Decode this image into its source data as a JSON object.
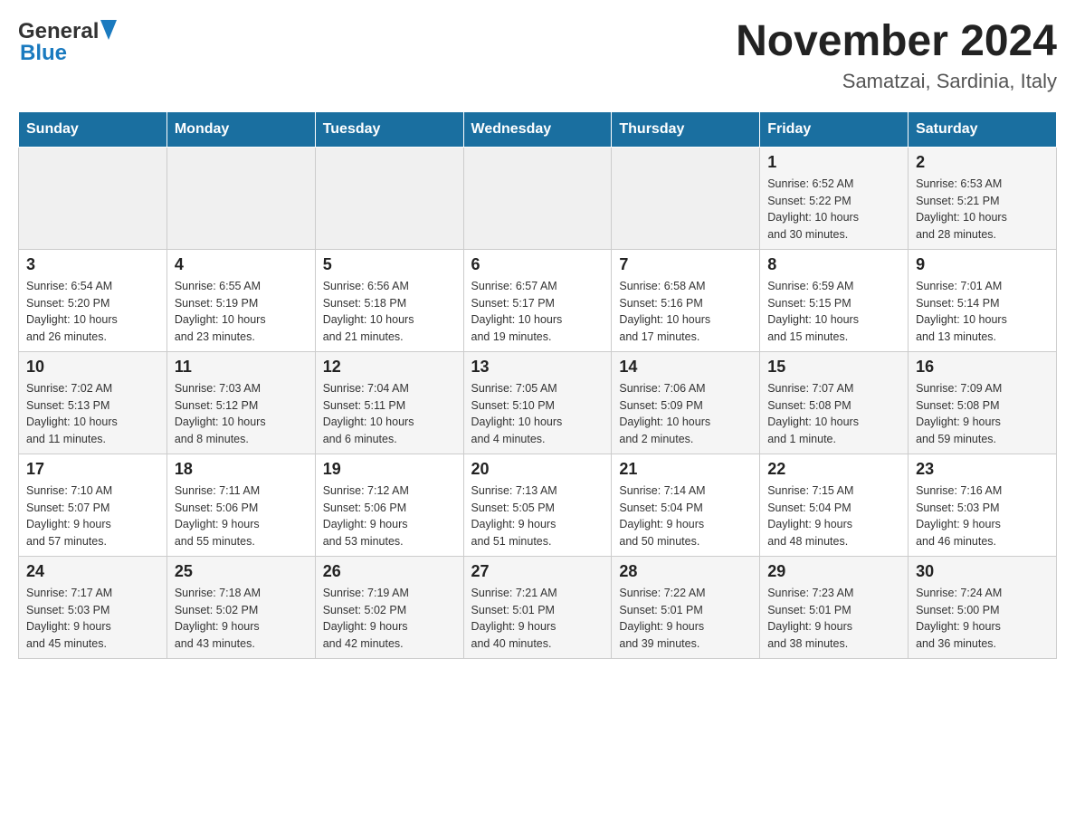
{
  "header": {
    "logo_general": "General",
    "logo_blue": "Blue",
    "title": "November 2024",
    "subtitle": "Samatzai, Sardinia, Italy"
  },
  "weekdays": [
    "Sunday",
    "Monday",
    "Tuesday",
    "Wednesday",
    "Thursday",
    "Friday",
    "Saturday"
  ],
  "weeks": [
    [
      {
        "day": "",
        "info": ""
      },
      {
        "day": "",
        "info": ""
      },
      {
        "day": "",
        "info": ""
      },
      {
        "day": "",
        "info": ""
      },
      {
        "day": "",
        "info": ""
      },
      {
        "day": "1",
        "info": "Sunrise: 6:52 AM\nSunset: 5:22 PM\nDaylight: 10 hours\nand 30 minutes."
      },
      {
        "day": "2",
        "info": "Sunrise: 6:53 AM\nSunset: 5:21 PM\nDaylight: 10 hours\nand 28 minutes."
      }
    ],
    [
      {
        "day": "3",
        "info": "Sunrise: 6:54 AM\nSunset: 5:20 PM\nDaylight: 10 hours\nand 26 minutes."
      },
      {
        "day": "4",
        "info": "Sunrise: 6:55 AM\nSunset: 5:19 PM\nDaylight: 10 hours\nand 23 minutes."
      },
      {
        "day": "5",
        "info": "Sunrise: 6:56 AM\nSunset: 5:18 PM\nDaylight: 10 hours\nand 21 minutes."
      },
      {
        "day": "6",
        "info": "Sunrise: 6:57 AM\nSunset: 5:17 PM\nDaylight: 10 hours\nand 19 minutes."
      },
      {
        "day": "7",
        "info": "Sunrise: 6:58 AM\nSunset: 5:16 PM\nDaylight: 10 hours\nand 17 minutes."
      },
      {
        "day": "8",
        "info": "Sunrise: 6:59 AM\nSunset: 5:15 PM\nDaylight: 10 hours\nand 15 minutes."
      },
      {
        "day": "9",
        "info": "Sunrise: 7:01 AM\nSunset: 5:14 PM\nDaylight: 10 hours\nand 13 minutes."
      }
    ],
    [
      {
        "day": "10",
        "info": "Sunrise: 7:02 AM\nSunset: 5:13 PM\nDaylight: 10 hours\nand 11 minutes."
      },
      {
        "day": "11",
        "info": "Sunrise: 7:03 AM\nSunset: 5:12 PM\nDaylight: 10 hours\nand 8 minutes."
      },
      {
        "day": "12",
        "info": "Sunrise: 7:04 AM\nSunset: 5:11 PM\nDaylight: 10 hours\nand 6 minutes."
      },
      {
        "day": "13",
        "info": "Sunrise: 7:05 AM\nSunset: 5:10 PM\nDaylight: 10 hours\nand 4 minutes."
      },
      {
        "day": "14",
        "info": "Sunrise: 7:06 AM\nSunset: 5:09 PM\nDaylight: 10 hours\nand 2 minutes."
      },
      {
        "day": "15",
        "info": "Sunrise: 7:07 AM\nSunset: 5:08 PM\nDaylight: 10 hours\nand 1 minute."
      },
      {
        "day": "16",
        "info": "Sunrise: 7:09 AM\nSunset: 5:08 PM\nDaylight: 9 hours\nand 59 minutes."
      }
    ],
    [
      {
        "day": "17",
        "info": "Sunrise: 7:10 AM\nSunset: 5:07 PM\nDaylight: 9 hours\nand 57 minutes."
      },
      {
        "day": "18",
        "info": "Sunrise: 7:11 AM\nSunset: 5:06 PM\nDaylight: 9 hours\nand 55 minutes."
      },
      {
        "day": "19",
        "info": "Sunrise: 7:12 AM\nSunset: 5:06 PM\nDaylight: 9 hours\nand 53 minutes."
      },
      {
        "day": "20",
        "info": "Sunrise: 7:13 AM\nSunset: 5:05 PM\nDaylight: 9 hours\nand 51 minutes."
      },
      {
        "day": "21",
        "info": "Sunrise: 7:14 AM\nSunset: 5:04 PM\nDaylight: 9 hours\nand 50 minutes."
      },
      {
        "day": "22",
        "info": "Sunrise: 7:15 AM\nSunset: 5:04 PM\nDaylight: 9 hours\nand 48 minutes."
      },
      {
        "day": "23",
        "info": "Sunrise: 7:16 AM\nSunset: 5:03 PM\nDaylight: 9 hours\nand 46 minutes."
      }
    ],
    [
      {
        "day": "24",
        "info": "Sunrise: 7:17 AM\nSunset: 5:03 PM\nDaylight: 9 hours\nand 45 minutes."
      },
      {
        "day": "25",
        "info": "Sunrise: 7:18 AM\nSunset: 5:02 PM\nDaylight: 9 hours\nand 43 minutes."
      },
      {
        "day": "26",
        "info": "Sunrise: 7:19 AM\nSunset: 5:02 PM\nDaylight: 9 hours\nand 42 minutes."
      },
      {
        "day": "27",
        "info": "Sunrise: 7:21 AM\nSunset: 5:01 PM\nDaylight: 9 hours\nand 40 minutes."
      },
      {
        "day": "28",
        "info": "Sunrise: 7:22 AM\nSunset: 5:01 PM\nDaylight: 9 hours\nand 39 minutes."
      },
      {
        "day": "29",
        "info": "Sunrise: 7:23 AM\nSunset: 5:01 PM\nDaylight: 9 hours\nand 38 minutes."
      },
      {
        "day": "30",
        "info": "Sunrise: 7:24 AM\nSunset: 5:00 PM\nDaylight: 9 hours\nand 36 minutes."
      }
    ]
  ]
}
